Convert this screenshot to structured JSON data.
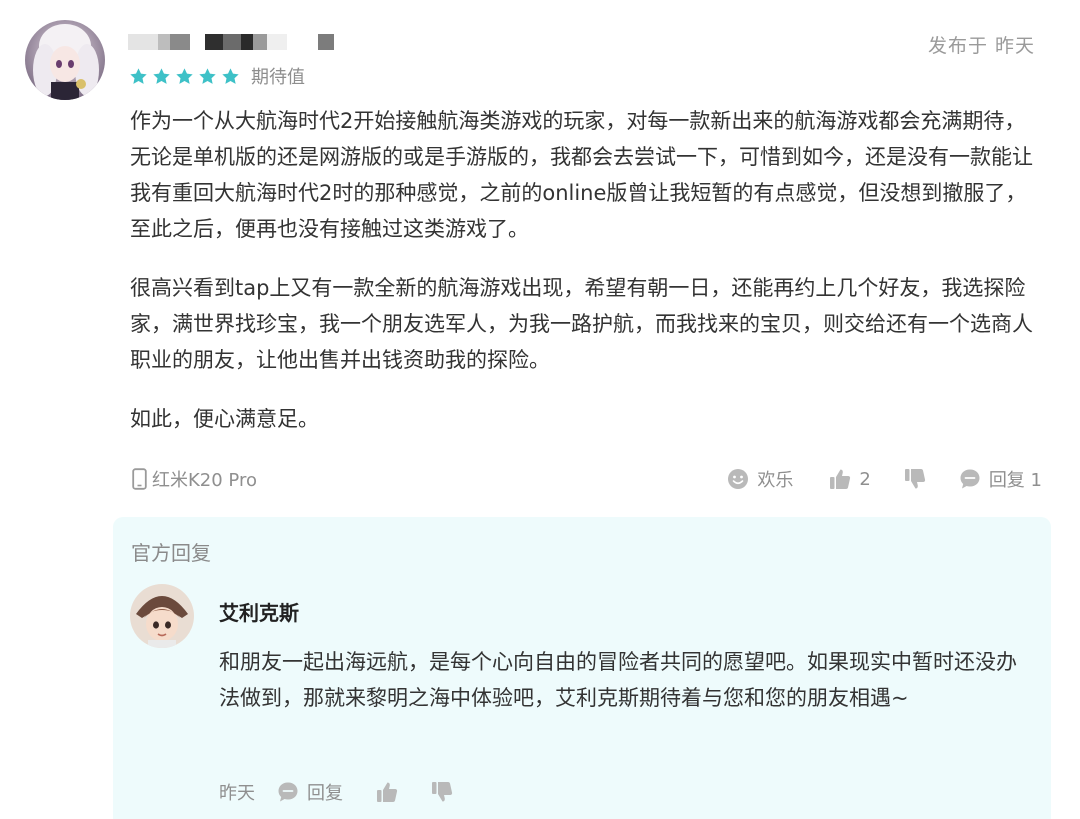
{
  "review": {
    "post_time": "发布于 昨天",
    "rating": 5,
    "rating_label": "期待值",
    "paragraphs": [
      "作为一个从大航海时代2开始接触航海类游戏的玩家，对每一款新出来的航海游戏都会充满期待，无论是单机版的还是网游版的或是手游版的，我都会去尝试一下，可惜到如今，还是没有一款能让我有重回大航海时代2时的那种感觉，之前的online版曾让我短暂的有点感觉，但没想到撤服了，至此之后，便再也没有接触过这类游戏了。",
      "很高兴看到tap上又有一款全新的航海游戏出现，希望有朝一日，还能再约上几个好友，我选探险家，满世界找珍宝，我一个朋友选军人，为我一路护航，而我找来的宝贝，则交给还有一个选商人职业的朋友，让他出售并出钱资助我的探险。",
      "如此，便心满意足。"
    ],
    "device": "红米K20 Pro",
    "happy_label": "欢乐",
    "like_count": "2",
    "reply_label": "回复 1"
  },
  "official": {
    "section_title": "官方回复",
    "name": "艾利克斯",
    "text": "和朋友一起出海远航，是每个心向自由的冒险者共同的愿望吧。如果现实中暂时还没办法做到，那就来黎明之海中体验吧，艾利克斯期待着与您和您的朋友相遇~",
    "time": "昨天",
    "reply_label": "回复"
  },
  "colors": {
    "star": "#3ec1c7",
    "muted": "#8f8f8f",
    "official_bg": "#eefbfc",
    "body_text": "#333333"
  },
  "icons": [
    "star-icon",
    "phone-icon",
    "smile-icon",
    "thumbs-up-icon",
    "thumbs-down-icon",
    "comment-icon"
  ]
}
